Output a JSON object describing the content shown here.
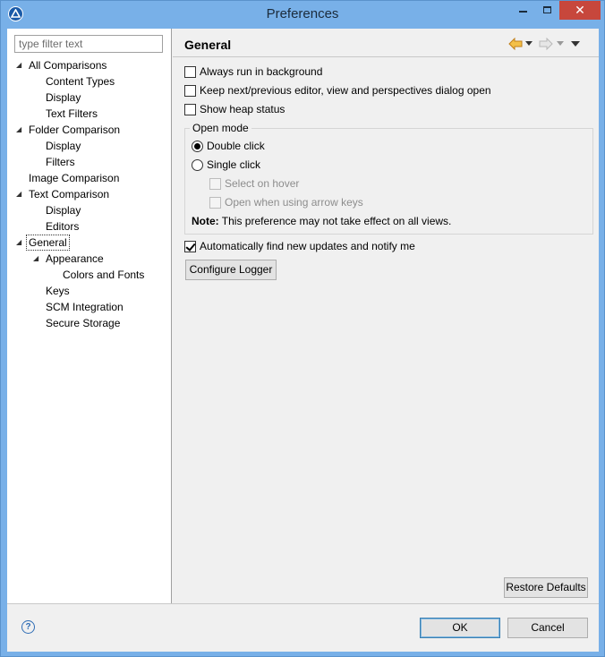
{
  "window": {
    "title": "Preferences",
    "close_glyph": "✕",
    "icon": "app-logo-icon"
  },
  "filter": {
    "placeholder": "type filter text"
  },
  "tree": {
    "items": [
      {
        "label": "All Comparisons",
        "level": 0,
        "expanded": true
      },
      {
        "label": "Content Types",
        "level": 1
      },
      {
        "label": "Display",
        "level": 1
      },
      {
        "label": "Text Filters",
        "level": 1
      },
      {
        "label": "Folder Comparison",
        "level": 0,
        "expanded": true
      },
      {
        "label": "Display",
        "level": 1
      },
      {
        "label": "Filters",
        "level": 1
      },
      {
        "label": "Image Comparison",
        "level": 0
      },
      {
        "label": "Text Comparison",
        "level": 0,
        "expanded": true
      },
      {
        "label": "Display",
        "level": 1
      },
      {
        "label": "Editors",
        "level": 1
      },
      {
        "label": "General",
        "level": 0,
        "expanded": true,
        "selected": true
      },
      {
        "label": "Appearance",
        "level": 1,
        "expanded": true
      },
      {
        "label": "Colors and Fonts",
        "level": 2
      },
      {
        "label": "Keys",
        "level": 1
      },
      {
        "label": "SCM Integration",
        "level": 1
      },
      {
        "label": "Secure Storage",
        "level": 1
      }
    ]
  },
  "page": {
    "title": "General",
    "nav_icons": [
      "back-arrow-icon",
      "dropdown-icon",
      "forward-arrow-icon",
      "dropdown-icon",
      "view-menu-icon"
    ],
    "options": [
      {
        "label": "Always run in background",
        "checked": false
      },
      {
        "label": "Keep next/previous editor, view and perspectives dialog open",
        "checked": false
      },
      {
        "label": "Show heap status",
        "checked": false
      }
    ],
    "open_mode": {
      "label": "Open mode",
      "double_click": "Double click",
      "single_click": "Single click",
      "selected": "double_click",
      "select_on_hover": "Select on hover",
      "open_arrow_keys": "Open when using arrow keys",
      "note_label": "Note:",
      "note_text": "This preference may not take effect on all views."
    },
    "auto_update": {
      "label": "Automatically find new updates and notify me",
      "checked": true
    },
    "configure_logger": "Configure Logger",
    "restore_defaults": "Restore Defaults"
  },
  "footer": {
    "ok": "OK",
    "cancel": "Cancel",
    "help_glyph": "?"
  },
  "colors": {
    "title_bar": "#78b0e8",
    "close_button": "#c7473c",
    "dialog_bg": "#f0f0f0",
    "back_arrow": "#e8a33a"
  }
}
